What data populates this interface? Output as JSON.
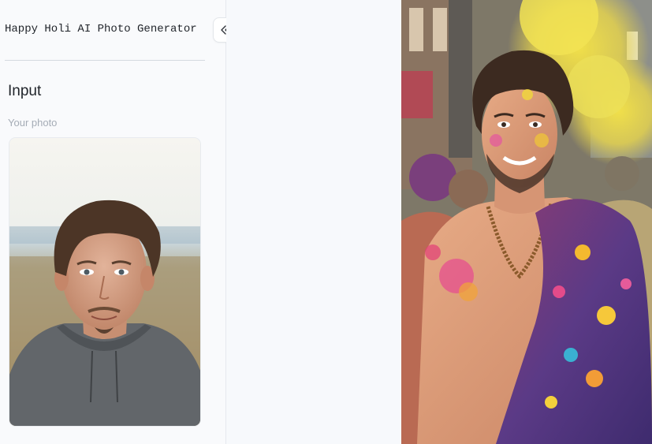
{
  "app": {
    "title": "Happy Holi AI Photo Generator"
  },
  "sidebar": {
    "collapse_button": {
      "icon": "double-chevron-left-icon"
    },
    "section_title": "Input",
    "photo_label": "Your photo"
  },
  "colors": {
    "sidebar_background": "#f9fafc",
    "main_background": "#f7f9fc",
    "text_primary": "#1f2329",
    "text_muted": "#a5acb6",
    "divider": "#d5d9df"
  },
  "images": {
    "input_photo": {
      "subject": "portrait of a smiling man with short brown hair and a goatee wearing a grey hoodie, outdoor field background"
    },
    "output_photo": {
      "subject": "Holi-styled portrait of the same man with colorful powder splashes, shirtless with a purple shawl and bead necklaces, festival crowd and yellow color cloud behind"
    }
  }
}
